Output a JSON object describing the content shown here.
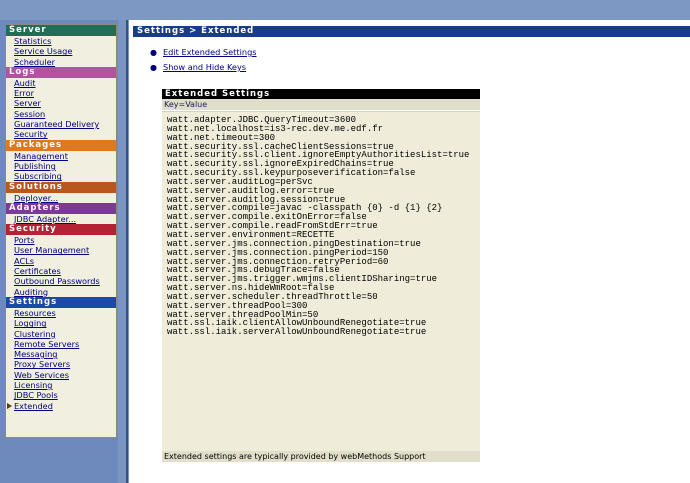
{
  "colors": {
    "server": "#1f6e55",
    "logs": "#b3529f",
    "packages": "#e0781e",
    "solutions": "#b8571e",
    "adapters": "#7b3a96",
    "security": "#b42335",
    "settings": "#1a4aa6"
  },
  "sidebar": [
    {
      "title": "Server",
      "color_key": "server",
      "items": [
        {
          "label": "Statistics"
        },
        {
          "label": "Service Usage"
        },
        {
          "label": "Scheduler"
        }
      ]
    },
    {
      "title": "Logs",
      "color_key": "logs",
      "items": [
        {
          "label": "Audit"
        },
        {
          "label": "Error"
        },
        {
          "label": "Server"
        },
        {
          "label": "Session"
        },
        {
          "label": "Guaranteed Delivery"
        },
        {
          "label": "Security"
        }
      ]
    },
    {
      "title": "Packages",
      "color_key": "packages",
      "items": [
        {
          "label": "Management"
        },
        {
          "label": "Publishing"
        },
        {
          "label": "Subscribing"
        }
      ]
    },
    {
      "title": "Solutions",
      "color_key": "solutions",
      "items": [
        {
          "label": "Deployer..."
        }
      ]
    },
    {
      "title": "Adapters",
      "color_key": "adapters",
      "items": [
        {
          "label": "JDBC Adapter..."
        }
      ]
    },
    {
      "title": "Security",
      "color_key": "security",
      "items": [
        {
          "label": "Ports"
        },
        {
          "label": "User Management"
        },
        {
          "label": "ACLs"
        },
        {
          "label": "Certificates"
        },
        {
          "label": "Outbound Passwords"
        },
        {
          "label": "Auditing"
        }
      ]
    },
    {
      "title": "Settings",
      "color_key": "settings",
      "items": [
        {
          "label": "Resources"
        },
        {
          "label": "Logging"
        },
        {
          "label": "Clustering"
        },
        {
          "label": "Remote Servers"
        },
        {
          "label": "Messaging"
        },
        {
          "label": "Proxy Servers"
        },
        {
          "label": "Web Services"
        },
        {
          "label": "Licensing"
        },
        {
          "label": "JDBC Pools"
        },
        {
          "label": "Extended",
          "selected": true
        }
      ]
    }
  ],
  "main": {
    "breadcrumb": "Settings > Extended",
    "links": [
      "Edit Extended Settings",
      "Show and Hide Keys"
    ],
    "table_title": "Extended Settings",
    "column_header": "Key=Value",
    "settings": [
      "watt.adapter.JDBC.QueryTimeout=3600",
      "watt.net.localhost=is3-rec.dev.me.edf.fr",
      "watt.net.timeout=300",
      "watt.security.ssl.cacheClientSessions=true",
      "watt.security.ssl.client.ignoreEmptyAuthoritiesList=true",
      "watt.security.ssl.ignoreExpiredChains=true",
      "watt.security.ssl.keypurposeverification=false",
      "watt.server.auditLog=perSvc",
      "watt.server.auditlog.error=true",
      "watt.server.auditlog.session=true",
      "watt.server.compile=javac -classpath {0} -d {1} {2}",
      "watt.server.compile.exitOnError=false",
      "watt.server.compile.readFromStdErr=true",
      "watt.server.environment=RECETTE",
      "watt.server.jms.connection.pingDestination=true",
      "watt.server.jms.connection.pingPeriod=150",
      "watt.server.jms.connection.retryPeriod=60",
      "watt.server.jms.debugTrace=false",
      "watt.server.jms.trigger.wmjms.clientIDSharing=true",
      "watt.server.ns.hideWmRoot=false",
      "watt.server.scheduler.threadThrottle=50",
      "watt.server.threadPool=300",
      "watt.server.threadPoolMin=50",
      "watt.ssl.iaik.clientAllowUnboundRenegotiate=true",
      "watt.ssl.iaik.serverAllowUnboundRenegotiate=true"
    ],
    "footer_note": "Extended settings are typically provided by webMethods Support"
  }
}
